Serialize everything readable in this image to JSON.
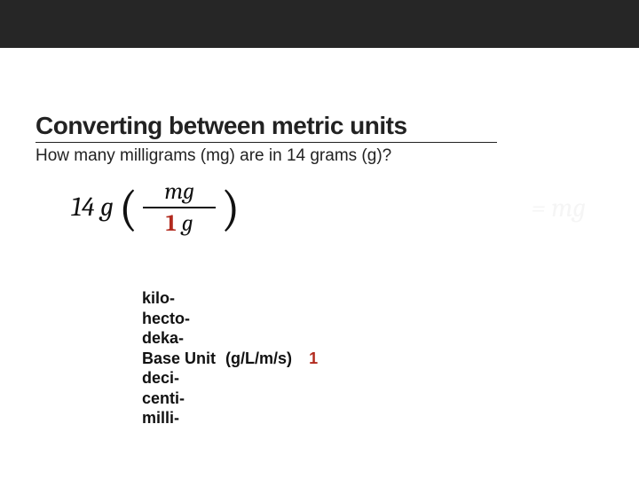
{
  "topbar": {},
  "title": "Converting between metric units",
  "question": "How many milligrams (mg) are in 14 grams (g)?",
  "equation": {
    "lead": "14 g",
    "paren_open": "(",
    "fraction": {
      "top": "mg",
      "bottom_num": "1",
      "bottom_unit": "g"
    },
    "paren_close": ")",
    "ghost_result": "= mg"
  },
  "prefixes": {
    "rows": [
      {
        "label": "kilo-"
      },
      {
        "label": "hecto-"
      },
      {
        "label": "deka-"
      },
      {
        "label": "Base Unit",
        "note": "(g/L/m/s)",
        "value": "1"
      },
      {
        "label": "deci-"
      },
      {
        "label": "centi-"
      },
      {
        "label": "milli-"
      }
    ]
  }
}
